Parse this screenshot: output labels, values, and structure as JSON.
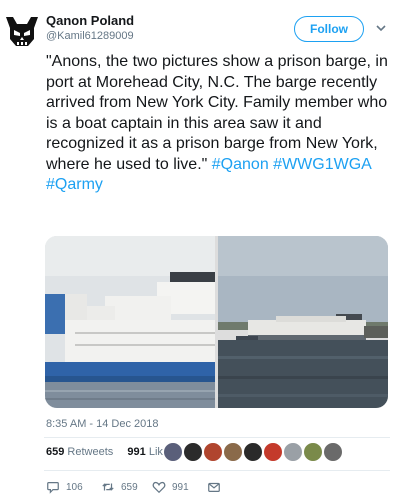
{
  "author": {
    "name": "Qanon Poland",
    "handle": "@Kamil61289009",
    "avatar_icon": "skull-logo-icon"
  },
  "follow_button": {
    "label": "Follow"
  },
  "menu": {
    "icon": "chevron-down-icon"
  },
  "tweet": {
    "text": "\"Anons, the two pictures show a prison barge, in port at Morehead City, N.C. The barge recently arrived from New York City. Family member who is a boat captain in this area saw it and recognized it as a prison barge from New York, where he used to live.\"",
    "hashtags": [
      "#Qanon",
      "#WWG1WGA",
      "#Qarmy"
    ],
    "timestamp": "8:35 AM - 14 Dec 2018"
  },
  "media": {
    "photos": [
      {
        "alt_icon": "barge-photo-closeup"
      },
      {
        "alt_icon": "barge-photo-harbor"
      }
    ]
  },
  "stats": {
    "retweets_count": "659",
    "retweets_label": "Retweets",
    "likes_count": "991",
    "likes_label": "Likes"
  },
  "likers": {
    "colors": [
      "#5a5f7a",
      "#2b2b2b",
      "#b0452e",
      "#8a6a4a",
      "#2a2a2a",
      "#c43a2b",
      "#9aa0a6",
      "#7a8a4a",
      "#6a6a6a"
    ]
  },
  "actions": {
    "reply_count": "106",
    "retweet_count": "659",
    "like_count": "991"
  },
  "colors": {
    "accent": "#1da1f2",
    "text": "#14171a",
    "muted": "#657786"
  }
}
